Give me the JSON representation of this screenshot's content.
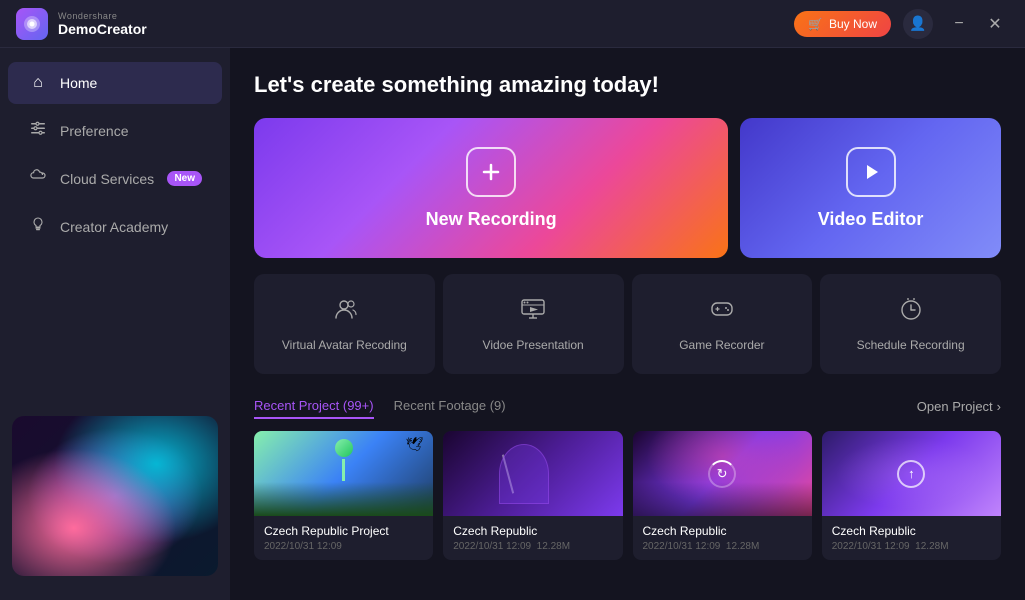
{
  "app": {
    "brand_top": "Wondershare",
    "brand_bottom": "DemoCreator",
    "logo_char": "W"
  },
  "titlebar": {
    "buy_now": "Buy Now",
    "minimize": "−",
    "close": "✕"
  },
  "sidebar": {
    "items": [
      {
        "id": "home",
        "label": "Home",
        "icon": "⌂",
        "active": true
      },
      {
        "id": "preference",
        "label": "Preference",
        "icon": "⊞",
        "active": false
      },
      {
        "id": "cloud",
        "label": "Cloud Services",
        "icon": "☁",
        "active": false,
        "badge": "New"
      },
      {
        "id": "creator",
        "label": "Creator Academy",
        "icon": "♥",
        "active": false
      }
    ]
  },
  "content": {
    "title": "Let's create something amazing today!",
    "hero_cards": [
      {
        "id": "new-recording",
        "label": "New Recording",
        "icon": "+"
      },
      {
        "id": "video-editor",
        "label": "Video Editor",
        "icon": "▶"
      }
    ],
    "feature_cards": [
      {
        "id": "virtual-avatar",
        "label": "Virtual Avatar Recoding",
        "icon": "👤"
      },
      {
        "id": "video-presentation",
        "label": "Vidoe Presentation",
        "icon": "🖥"
      },
      {
        "id": "game-recorder",
        "label": "Game Recorder",
        "icon": "🎮"
      },
      {
        "id": "schedule-recording",
        "label": "Schedule Recording",
        "icon": "⏰"
      }
    ],
    "recent_tabs": [
      {
        "id": "recent-project",
        "label": "Recent Project (99+)",
        "active": true
      },
      {
        "id": "recent-footage",
        "label": "Recent Footage (9)",
        "active": false
      }
    ],
    "open_project": "Open Project",
    "projects": [
      {
        "id": "proj-1",
        "name": "Czech Republic Project",
        "date": "2022/10/31 12:09",
        "size": "",
        "thumb": "1"
      },
      {
        "id": "proj-2",
        "name": "Czech Republic",
        "date": "2022/10/31 12:09",
        "size": "12.28M",
        "thumb": "2"
      },
      {
        "id": "proj-3",
        "name": "Czech Republic",
        "date": "2022/10/31 12:09",
        "size": "12.28M",
        "thumb": "3"
      },
      {
        "id": "proj-4",
        "name": "Czech Republic",
        "date": "2022/10/31 12:09",
        "size": "12.28M",
        "thumb": "4"
      }
    ]
  }
}
